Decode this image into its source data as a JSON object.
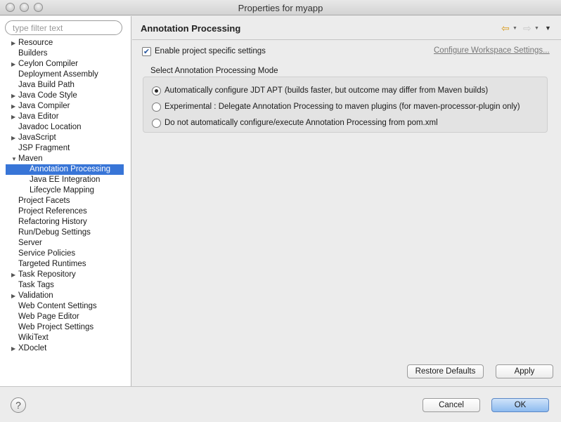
{
  "window": {
    "title": "Properties for myapp"
  },
  "sidebar": {
    "filter_placeholder": "type filter text",
    "items": [
      {
        "label": "Resource",
        "arrow": "▶"
      },
      {
        "label": "Builders",
        "arrow": ""
      },
      {
        "label": "Ceylon Compiler",
        "arrow": "▶"
      },
      {
        "label": "Deployment Assembly",
        "arrow": ""
      },
      {
        "label": "Java Build Path",
        "arrow": ""
      },
      {
        "label": "Java Code Style",
        "arrow": "▶"
      },
      {
        "label": "Java Compiler",
        "arrow": "▶"
      },
      {
        "label": "Java Editor",
        "arrow": "▶"
      },
      {
        "label": "Javadoc Location",
        "arrow": ""
      },
      {
        "label": "JavaScript",
        "arrow": "▶"
      },
      {
        "label": "JSP Fragment",
        "arrow": ""
      },
      {
        "label": "Maven",
        "arrow": "▼"
      },
      {
        "label": "Annotation Processing",
        "arrow": "",
        "child": true,
        "selected": true
      },
      {
        "label": "Java EE Integration",
        "arrow": "",
        "child": true
      },
      {
        "label": "Lifecycle Mapping",
        "arrow": "",
        "child": true
      },
      {
        "label": "Project Facets",
        "arrow": ""
      },
      {
        "label": "Project References",
        "arrow": ""
      },
      {
        "label": "Refactoring History",
        "arrow": ""
      },
      {
        "label": "Run/Debug Settings",
        "arrow": ""
      },
      {
        "label": "Server",
        "arrow": ""
      },
      {
        "label": "Service Policies",
        "arrow": ""
      },
      {
        "label": "Targeted Runtimes",
        "arrow": ""
      },
      {
        "label": "Task Repository",
        "arrow": "▶"
      },
      {
        "label": "Task Tags",
        "arrow": ""
      },
      {
        "label": "Validation",
        "arrow": "▶"
      },
      {
        "label": "Web Content Settings",
        "arrow": ""
      },
      {
        "label": "Web Page Editor",
        "arrow": ""
      },
      {
        "label": "Web Project Settings",
        "arrow": ""
      },
      {
        "label": "WikiText",
        "arrow": ""
      },
      {
        "label": "XDoclet",
        "arrow": "▶"
      }
    ]
  },
  "content": {
    "title": "Annotation Processing",
    "enable_label": "Enable project specific settings",
    "enable_checked": true,
    "workspace_link": "Configure Workspace Settings...",
    "group_title": "Select Annotation Processing Mode",
    "options": [
      {
        "label": "Automatically configure JDT APT (builds faster, but outcome may differ from Maven builds)",
        "selected": true
      },
      {
        "label": "Experimental : Delegate Annotation Processing to maven plugins (for maven-processor-plugin only)",
        "selected": false
      },
      {
        "label": "Do not automatically configure/execute Annotation Processing from pom.xml",
        "selected": false
      }
    ],
    "restore_defaults_label": "Restore Defaults",
    "apply_label": "Apply"
  },
  "footer": {
    "help_glyph": "?",
    "cancel_label": "Cancel",
    "ok_label": "OK"
  },
  "colors": {
    "selection": "#3875d7",
    "ok_button": "#8dbbef"
  }
}
